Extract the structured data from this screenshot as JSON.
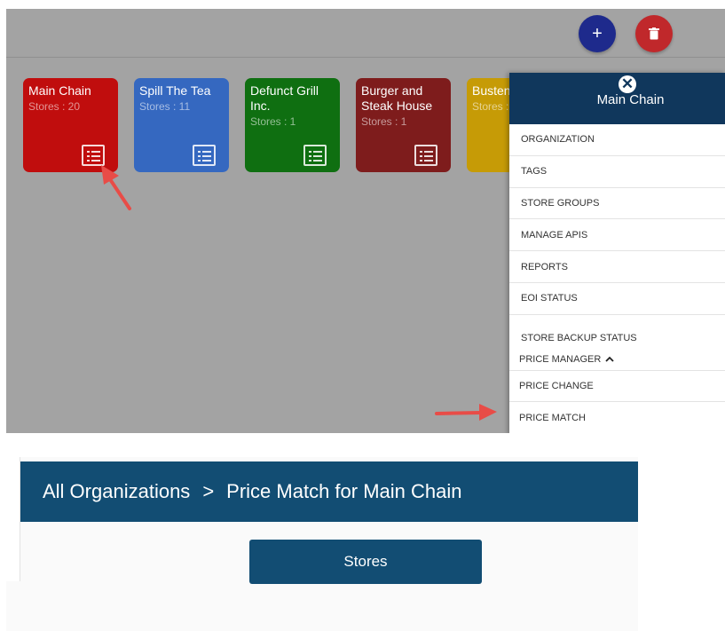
{
  "topbar": {
    "add_icon": "+",
    "delete_icon": "trash-icon"
  },
  "cards": [
    {
      "name": "Main Chain",
      "stores": "Stores : 20",
      "color": "#c00d0d"
    },
    {
      "name": "Spill The Tea",
      "stores": "Stores : 11",
      "color": "#3568c0"
    },
    {
      "name": "Defunct Grill Inc.",
      "stores": "Stores : 1",
      "color": "#0f6f11"
    },
    {
      "name": "Burger and Steak House",
      "stores": "Stores : 1",
      "color": "#7e1c1c"
    },
    {
      "name": "Busten",
      "stores": "Stores :",
      "color": "#c69b06"
    }
  ],
  "drawer": {
    "close_icon": "✕",
    "title": "Main Chain",
    "items": [
      "ORGANIZATION",
      "TAGS",
      "STORE GROUPS",
      "MANAGE APIS",
      "REPORTS",
      "EOI STATUS",
      "STORE BACKUP STATUS"
    ],
    "price_manager": "PRICE MANAGER",
    "price_manager_icon": "chevron-up-icon",
    "sub_items": [
      "PRICE CHANGE",
      "PRICE MATCH"
    ]
  },
  "header2": {
    "breadcrumb_root": "All Organizations",
    "separator": ">",
    "current": "Price Match for Main Chain"
  },
  "stores_button": "Stores",
  "colors": {
    "fab_add": "#1e2a8c",
    "fab_delete": "#c0282b",
    "drawer_header": "#10375c",
    "page_header": "#124d73",
    "annotation_arrow": "#e84c47"
  }
}
